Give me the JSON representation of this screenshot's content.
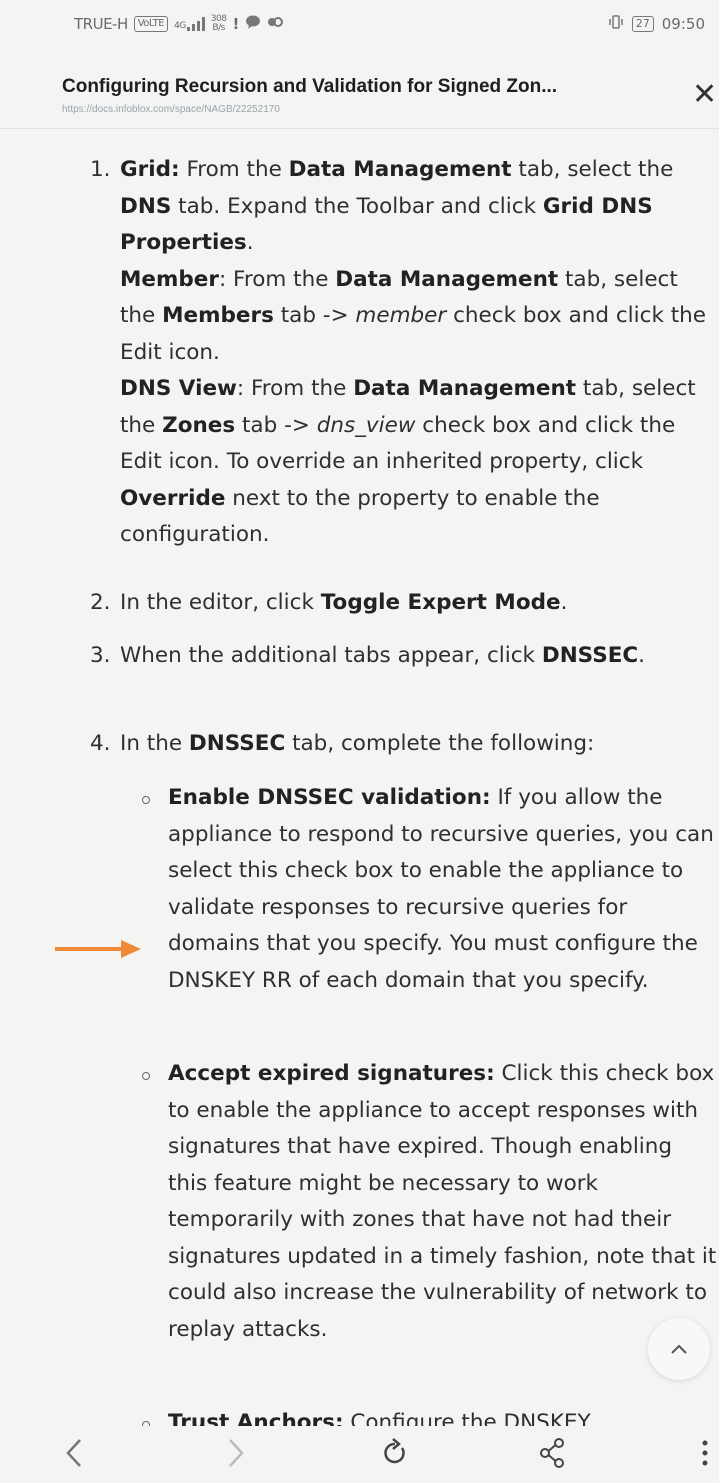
{
  "status_bar": {
    "carrier": "TRUE-H",
    "sim_label": "VoLTE",
    "net_type": "4G",
    "speed_value": "308",
    "speed_unit": "B/s",
    "time": "09:50",
    "battery": "27"
  },
  "header": {
    "title": "Configuring Recursion and Validation for Signed Zon...",
    "url": "https://docs.infoblox.com/space/NAGB/22252170"
  },
  "steps": [
    {
      "num": "1.",
      "paragraphs": [
        [
          {
            "t": "Grid:",
            "b": true
          },
          {
            "t": " From the "
          },
          {
            "t": "Data Management",
            "b": true
          },
          {
            "t": " tab, select the "
          },
          {
            "t": "DNS",
            "b": true
          },
          {
            "t": " tab. Expand the Toolbar and click "
          },
          {
            "t": "Grid DNS Properties",
            "b": true
          },
          {
            "t": "."
          }
        ],
        [
          {
            "t": "Member",
            "b": true
          },
          {
            "t": ": From the "
          },
          {
            "t": "Data Management",
            "b": true
          },
          {
            "t": " tab, select the "
          },
          {
            "t": "Members",
            "b": true
          },
          {
            "t": " tab -> "
          },
          {
            "t": "member",
            "i": true
          },
          {
            "t": " check box and click the Edit icon."
          }
        ],
        [
          {
            "t": "DNS View",
            "b": true
          },
          {
            "t": ": From the "
          },
          {
            "t": "Data Management",
            "b": true
          },
          {
            "t": " tab, select the "
          },
          {
            "t": "Zones",
            "b": true
          },
          {
            "t": " tab -> "
          },
          {
            "t": "dns_view",
            "i": true
          },
          {
            "t": " check box and click the Edit icon. To override an inherited property, click "
          },
          {
            "t": "Override",
            "b": true
          },
          {
            "t": " next to the property to enable the configuration."
          }
        ]
      ]
    },
    {
      "num": "2.",
      "paragraphs": [
        [
          {
            "t": "In the editor, click "
          },
          {
            "t": "Toggle Expert Mode",
            "b": true
          },
          {
            "t": "."
          }
        ]
      ]
    },
    {
      "num": "3.",
      "paragraphs": [
        [
          {
            "t": "When the additional tabs appear, click "
          },
          {
            "t": "DNSSEC",
            "b": true
          },
          {
            "t": "."
          }
        ]
      ]
    },
    {
      "num": "4.",
      "paragraphs": [
        [
          {
            "t": "In the "
          },
          {
            "t": "DNSSEC",
            "b": true
          },
          {
            "t": " tab, complete the following:"
          }
        ]
      ]
    }
  ],
  "sub_items": [
    [
      {
        "t": "Enable DNSSEC validation:",
        "b": true
      },
      {
        "t": " If you allow the appliance to respond to recursive queries, you can select this check box to enable the appliance to validate responses to recursive queries for domains that you specify. You must configure the DNSKEY RR of each domain that you specify."
      }
    ],
    [
      {
        "t": "Accept expired signatures:",
        "b": true
      },
      {
        "t": " Click this check box to enable the appliance to accept responses with signatures that have expired. Though enabling this feature might be necessary to work temporarily with zones that have not had their signatures updated in a timely fashion, note that it could also increase the vulnerability of network to replay attacks."
      }
    ],
    [
      {
        "t": "Trust Anchors:",
        "b": true
      },
      {
        "t": " Configure the DNSKEY"
      }
    ]
  ],
  "colors": {
    "arrow": "#f08a36",
    "text": "#2f2f2f",
    "url": "#9aa3ad"
  },
  "icons": [
    "back-icon",
    "forward-icon",
    "reload-icon",
    "share-icon",
    "more-icon",
    "close-icon",
    "chevron-up-icon"
  ]
}
